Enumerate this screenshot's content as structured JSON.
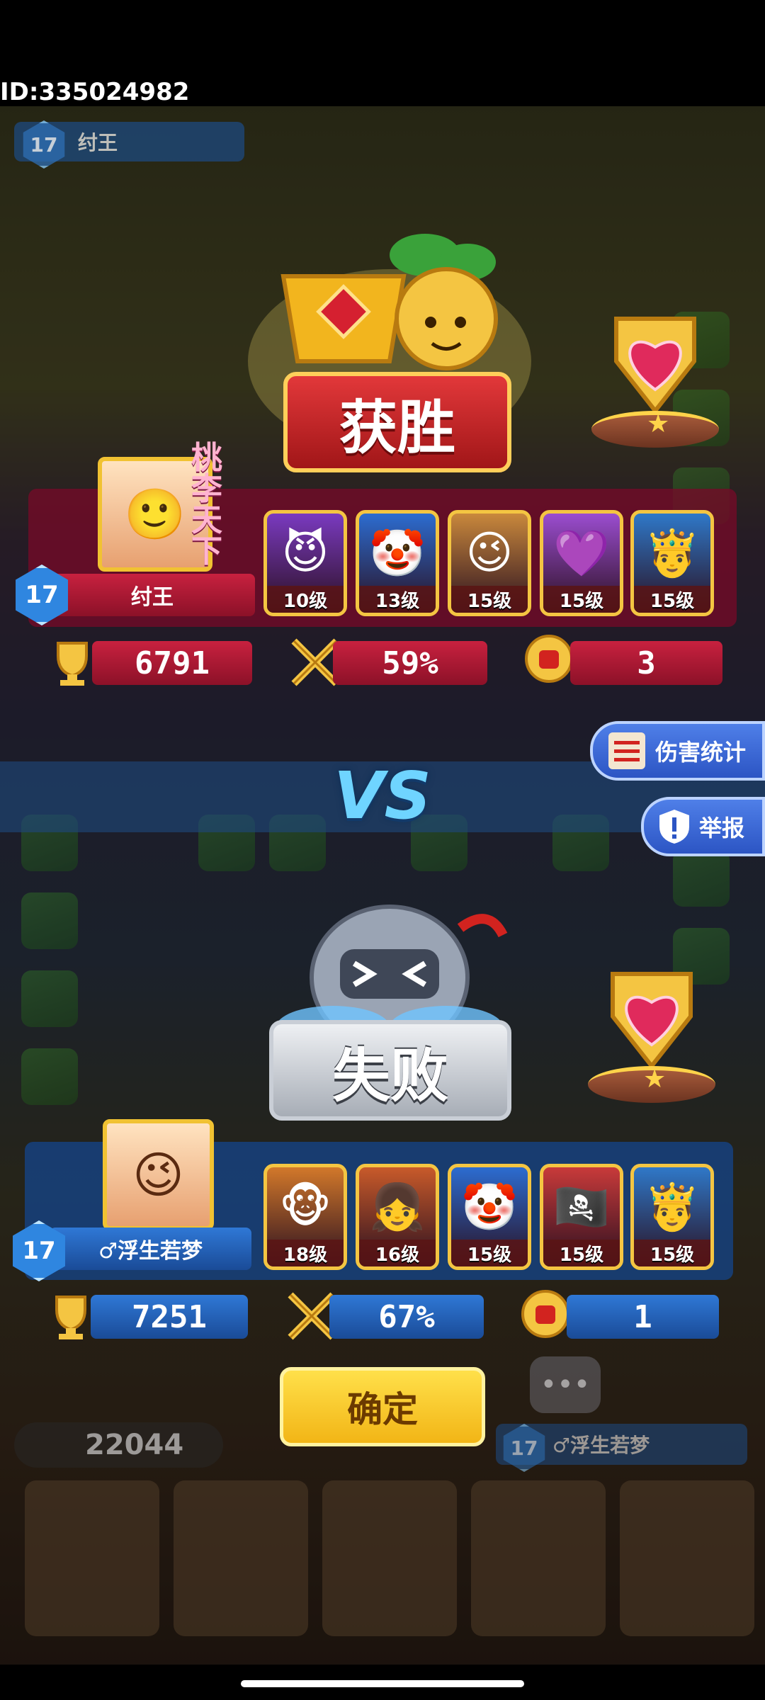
{
  "player_id": "ID:335024982",
  "background_header": {
    "level": "17",
    "name": "纣王"
  },
  "winner": {
    "result_label": "获胜",
    "level": "17",
    "name": "纣王",
    "title_stamp": "桃李天下",
    "heroes": [
      {
        "level_label": "10级",
        "face": "😈",
        "color": "#7a3ac0"
      },
      {
        "level_label": "13级",
        "face": "🤡",
        "color": "#2c6cd0"
      },
      {
        "level_label": "15级",
        "face": "😉",
        "color": "#c9883c"
      },
      {
        "level_label": "15级",
        "face": "💜",
        "color": "#9b4dd0"
      },
      {
        "level_label": "15级",
        "face": "🤴",
        "color": "#2f78c8"
      }
    ],
    "trophies": "6791",
    "win_rate": "59%",
    "mvp_count": "3"
  },
  "loser": {
    "result_label": "失败",
    "level": "17",
    "name": "♂浮生若梦",
    "heroes": [
      {
        "level_label": "18级",
        "face": "🐵",
        "color": "#d2782a"
      },
      {
        "level_label": "16级",
        "face": "👧",
        "color": "#c85a2a"
      },
      {
        "level_label": "15级",
        "face": "🤡",
        "color": "#2c6cd0"
      },
      {
        "level_label": "15级",
        "face": "🏴‍☠️",
        "color": "#c83a3a"
      },
      {
        "level_label": "15级",
        "face": "🤴",
        "color": "#2f78c8"
      }
    ],
    "trophies": "7251",
    "win_rate": "67%",
    "mvp_count": "1"
  },
  "vs_label": "VS",
  "side_buttons": {
    "damage_stats": "伤害统计",
    "report": "举报"
  },
  "confirm_label": "确定",
  "background_footer": {
    "coins": "22044",
    "level": "17",
    "name": "♂浮生若梦"
  },
  "colors": {
    "win_red": "#c8213f",
    "lose_blue": "#2f78d6",
    "gold": "#f1c232",
    "vs": "#6fd4ff"
  }
}
